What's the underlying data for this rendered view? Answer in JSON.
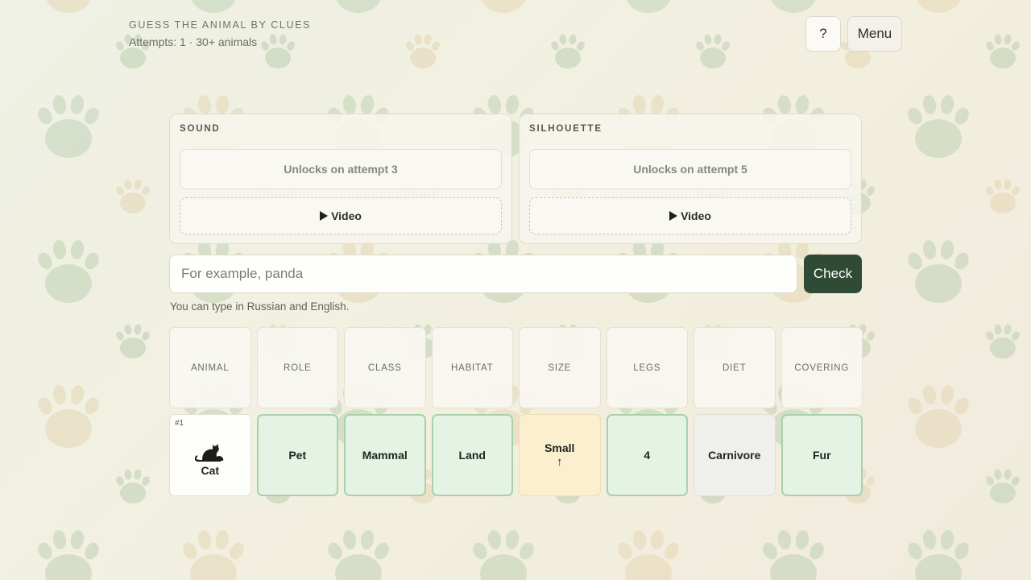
{
  "header": {
    "subtitle": "GUESS THE ANIMAL BY CLUES",
    "attempts": "Attempts: 1 · 30+ animals"
  },
  "toolbar": {
    "help_label": "?",
    "menu_label": "Menu"
  },
  "clues": [
    {
      "title": "SOUND",
      "lock_text": "Unlocks on attempt 3",
      "video_label": "Video"
    },
    {
      "title": "SILHOUETTE",
      "lock_text": "Unlocks on attempt 5",
      "video_label": "Video"
    }
  ],
  "guess": {
    "placeholder": "For example, panda",
    "value": "",
    "check_label": "Check",
    "hint": "You can type in Russian and English."
  },
  "table": {
    "headers": [
      "ANIMAL",
      "ROLE",
      "CLASS",
      "HABITAT",
      "SIZE",
      "LEGS",
      "DIET",
      "COVERING"
    ],
    "rows": [
      {
        "index": "#1",
        "animal": "Cat",
        "animal_icon": "cat-silhouette-icon",
        "cells": [
          {
            "value": "Pet",
            "status": "match"
          },
          {
            "value": "Mammal",
            "status": "match"
          },
          {
            "value": "Land",
            "status": "match"
          },
          {
            "value": "Small",
            "status": "close",
            "arrow": "↑"
          },
          {
            "value": "4",
            "status": "match"
          },
          {
            "value": "Carnivore",
            "status": "miss"
          },
          {
            "value": "Fur",
            "status": "match"
          }
        ]
      }
    ]
  },
  "colors": {
    "match_bg": "#e5f3e5",
    "match_border": "#a8d1ab",
    "close_bg": "#fcefcf",
    "miss_bg": "#efefec",
    "check_button": "#2f4a35",
    "paw_green": "#bccfb0",
    "paw_tan": "#e3d6b2"
  }
}
